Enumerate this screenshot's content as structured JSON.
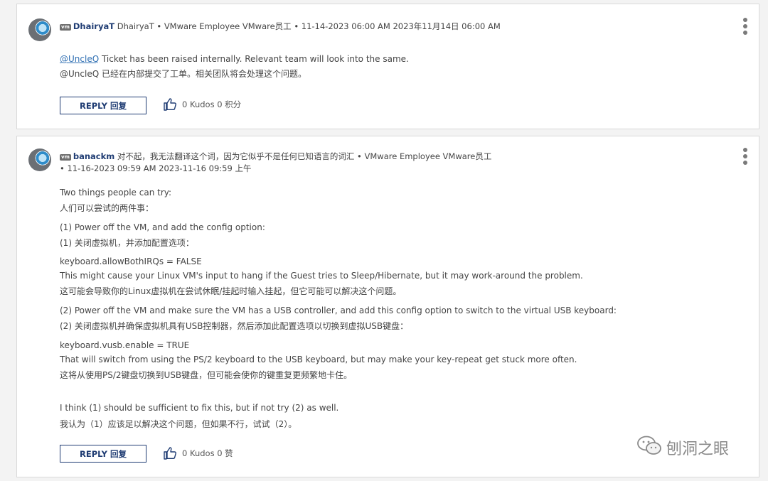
{
  "post1": {
    "author": "DhairyaT",
    "meta": " DhairyaT • VMware Employee  VMware员工 • 11-14-2023 06:00 AM 2023年11月14日 06:00 AM",
    "badge": "vm",
    "mention": "@UncleQ",
    "line1_rest": " Ticket has been raised internally. Relevant team will look into the same.",
    "line2": "@UncleQ 已经在内部提交了工单。相关团队将会处理这个问题。",
    "reply_label": "REPLY 回复",
    "kudos": "0 Kudos 0 积分"
  },
  "post2": {
    "author": "banackm",
    "badge": "vm",
    "meta1": " 对不起，我无法翻译这个词，因为它似乎不是任何已知语言的词汇 • VMware Employee  VMware员工",
    "meta2": "• 11-16-2023 09:59 AM 2023-11-16 09:59 上午",
    "lines": [
      "Two things people can try:",
      "人们可以尝试的两件事：",
      "(1) Power off the VM, and add the config option:",
      "(1) 关闭虚拟机，并添加配置选项：",
      "keyboard.allowBothIRQs = FALSE",
      "This might cause your Linux VM's input to hang if the Guest tries to Sleep/Hibernate, but it may work-around the problem.",
      "这可能会导致你的Linux虚拟机在尝试休眠/挂起时输入挂起，但它可能可以解决这个问题。",
      "(2) Power off the VM and make sure the VM has a USB controller, and add this config option to switch to the virtual USB keyboard:",
      "(2) 关闭虚拟机并确保虚拟机具有USB控制器，然后添加此配置选项以切换到虚拟USB键盘：",
      "keyboard.vusb.enable = TRUE",
      "That will switch from using the PS/2 keyboard to the USB keyboard, but may make your key-repeat get stuck more often.",
      "这将从使用PS/2键盘切换到USB键盘，但可能会使你的键重复更频繁地卡住。",
      "I think (1) should be sufficient to fix this, but if not try (2) as well.",
      "我认为（1）应该足以解决这个问题，但如果不行，试试（2）。"
    ],
    "reply_label": "REPLY 回复",
    "kudos": "0 Kudos 0 赞"
  },
  "watermark": "刨洞之眼"
}
